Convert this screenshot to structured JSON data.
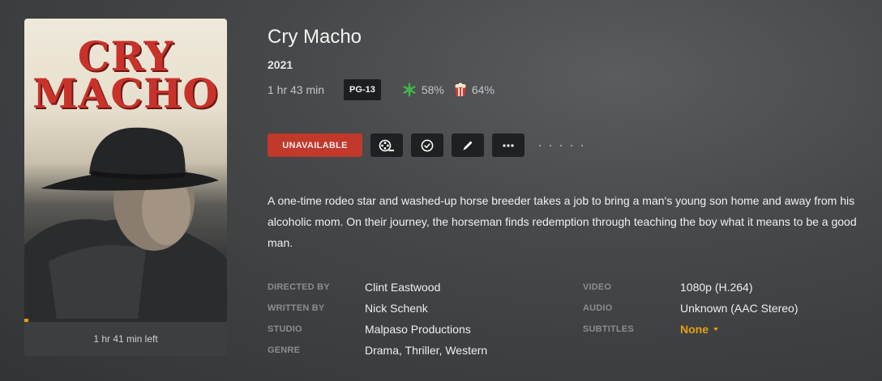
{
  "poster": {
    "title_line1": "CRY",
    "title_line2": "MACHO",
    "progress_fraction": 0.02,
    "time_left": "1 hr 41 min left"
  },
  "movie": {
    "title": "Cry Macho",
    "year": "2021",
    "runtime": "1 hr 43 min",
    "content_rating": "PG-13",
    "critic_score": "58%",
    "critic_icon": "rt-rotten-splat-icon",
    "audience_score": "64%",
    "audience_icon": "popcorn-icon",
    "summary": "A one-time rodeo star and washed-up horse breeder takes a job to bring a man's young son home and away from his alcoholic mom. On their journey, the horseman finds redemption through teaching the boy what it means to be a good man."
  },
  "actions": {
    "unavailable_label": "UNAVAILABLE",
    "icons": [
      "film-reel-icon",
      "check-circle-icon",
      "pencil-icon",
      "more-icon"
    ]
  },
  "details_left": [
    {
      "label": "DIRECTED BY",
      "value": "Clint Eastwood"
    },
    {
      "label": "WRITTEN BY",
      "value": "Nick Schenk"
    },
    {
      "label": "STUDIO",
      "value": "Malpaso Productions"
    },
    {
      "label": "GENRE",
      "value": "Drama, Thriller, Western"
    }
  ],
  "details_right": [
    {
      "label": "VIDEO",
      "value": "1080p (H.264)"
    },
    {
      "label": "AUDIO",
      "value": "Unknown (AAC Stereo)"
    },
    {
      "label": "SUBTITLES",
      "value": "None"
    }
  ],
  "colors": {
    "accent": "#e5a00d",
    "unavailable": "#c0392b",
    "critic_green": "#3fb44a",
    "popcorn_red": "#d93a2b"
  }
}
